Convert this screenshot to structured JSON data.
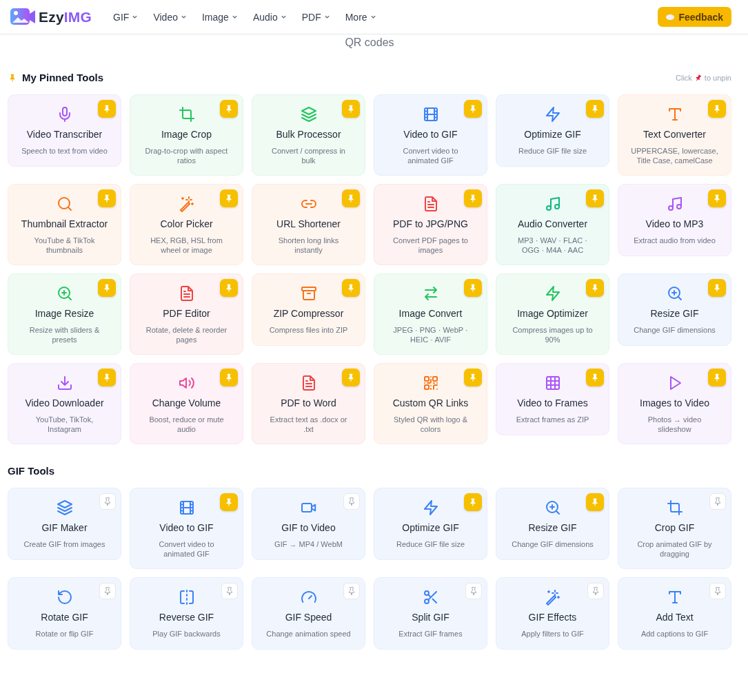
{
  "header": {
    "brand": {
      "name": "Ezy",
      "accent": "IMG"
    },
    "nav": [
      "GIF",
      "Video",
      "Image",
      "Audio",
      "PDF",
      "More"
    ],
    "feedback_button": "Feedback"
  },
  "intro_fragment": "QR codes",
  "sections": [
    {
      "title": "My Pinned Tools",
      "kind": "pinned",
      "hint": {
        "before": "Click",
        "after": "to unpin"
      },
      "tools": [
        {
          "title": "Video Transcriber",
          "description": "Speech to text from video",
          "kind": "mic",
          "color": "#a855f7",
          "pinned": true
        },
        {
          "title": "Image Crop",
          "description": "Drag-to-crop with aspect ratios",
          "kind": "crop",
          "color": "#22c55e",
          "pinned": true
        },
        {
          "title": "Bulk Processor",
          "description": "Convert / compress in bulk",
          "kind": "layers",
          "color": "#22c55e",
          "pinned": true
        },
        {
          "title": "Video to GIF",
          "description": "Convert video to animated GIF",
          "kind": "film",
          "color": "#3b82f6",
          "pinned": true
        },
        {
          "title": "Optimize GIF",
          "description": "Reduce GIF file size",
          "kind": "zap",
          "color": "#3b82f6",
          "pinned": true
        },
        {
          "title": "Text Converter",
          "description": "UPPERCASE, lowercase, Title Case, camelCase",
          "kind": "type",
          "color": "#f97316",
          "pinned": true
        },
        {
          "title": "Thumbnail Extractor",
          "description": "YouTube & TikTok thumbnails",
          "kind": "search",
          "color": "#f97316",
          "pinned": true
        },
        {
          "title": "Color Picker",
          "description": "HEX, RGB, HSL from wheel or image",
          "kind": "wand",
          "color": "#f97316",
          "pinned": true
        },
        {
          "title": "URL Shortener",
          "description": "Shorten long links instantly",
          "kind": "link",
          "color": "#f97316",
          "pinned": true
        },
        {
          "title": "PDF to JPG/PNG",
          "description": "Convert PDF pages to images",
          "kind": "file",
          "color": "#ef4444",
          "pinned": true
        },
        {
          "title": "Audio Converter",
          "description": "MP3 · WAV · FLAC · OGG · M4A · AAC",
          "kind": "music",
          "color": "#10b981",
          "pinned": true
        },
        {
          "title": "Video to MP3",
          "description": "Extract audio from video",
          "kind": "music",
          "color": "#a855f7",
          "pinned": true
        },
        {
          "title": "Image Resize",
          "description": "Resize with sliders & presets",
          "kind": "zoom",
          "color": "#22c55e",
          "pinned": true
        },
        {
          "title": "PDF Editor",
          "description": "Rotate, delete & reorder pages",
          "kind": "file",
          "color": "#ef4444",
          "pinned": true
        },
        {
          "title": "ZIP Compressor",
          "description": "Compress files into ZIP",
          "kind": "archive",
          "color": "#f97316",
          "pinned": true
        },
        {
          "title": "Image Convert",
          "description": "JPEG · PNG · WebP · HEIC · AVIF",
          "kind": "swap",
          "color": "#22c55e",
          "pinned": true
        },
        {
          "title": "Image Optimizer",
          "description": "Compress images up to 90%",
          "kind": "zap",
          "color": "#22c55e",
          "pinned": true
        },
        {
          "title": "Resize GIF",
          "description": "Change GIF dimensions",
          "kind": "zoom",
          "color": "#3b82f6",
          "pinned": true
        },
        {
          "title": "Video Downloader",
          "description": "YouTube, TikTok, Instagram",
          "kind": "download",
          "color": "#a855f7",
          "pinned": true
        },
        {
          "title": "Change Volume",
          "description": "Boost, reduce or mute audio",
          "kind": "volume",
          "color": "#ec4899",
          "pinned": true
        },
        {
          "title": "PDF to Word",
          "description": "Extract text as .docx or .txt",
          "kind": "file",
          "color": "#ef4444",
          "pinned": true
        },
        {
          "title": "Custom QR Links",
          "description": "Styled QR with logo & colors",
          "kind": "qr",
          "color": "#f97316",
          "pinned": true
        },
        {
          "title": "Video to Frames",
          "description": "Extract frames as ZIP",
          "kind": "grid",
          "color": "#a855f7",
          "pinned": true
        },
        {
          "title": "Images to Video",
          "description": "Photos → video slideshow",
          "kind": "play",
          "color": "#a855f7",
          "pinned": true
        }
      ]
    },
    {
      "title": "GIF Tools",
      "kind": "plain",
      "tools": [
        {
          "title": "GIF Maker",
          "description": "Create GIF from images",
          "kind": "layers",
          "color": "#3b82f6",
          "pinned": false
        },
        {
          "title": "Video to GIF",
          "description": "Convert video to animated GIF",
          "kind": "film",
          "color": "#3b82f6",
          "pinned": true
        },
        {
          "title": "GIF to Video",
          "description": "GIF → MP4 / WebM",
          "kind": "video",
          "color": "#3b82f6",
          "pinned": false
        },
        {
          "title": "Optimize GIF",
          "description": "Reduce GIF file size",
          "kind": "zap",
          "color": "#3b82f6",
          "pinned": true
        },
        {
          "title": "Resize GIF",
          "description": "Change GIF dimensions",
          "kind": "zoom",
          "color": "#3b82f6",
          "pinned": true
        },
        {
          "title": "Crop GIF",
          "description": "Crop animated GIF by dragging",
          "kind": "crop",
          "color": "#3b82f6",
          "pinned": false
        },
        {
          "title": "Rotate GIF",
          "description": "Rotate or flip GIF",
          "kind": "rotate",
          "color": "#3b82f6",
          "pinned": false
        },
        {
          "title": "Reverse GIF",
          "description": "Play GIF backwards",
          "kind": "split",
          "color": "#3b82f6",
          "pinned": false
        },
        {
          "title": "GIF Speed",
          "description": "Change animation speed",
          "kind": "gauge",
          "color": "#3b82f6",
          "pinned": false
        },
        {
          "title": "Split GIF",
          "description": "Extract GIF frames",
          "kind": "scissors",
          "color": "#3b82f6",
          "pinned": false
        },
        {
          "title": "GIF Effects",
          "description": "Apply filters to GIF",
          "kind": "wand",
          "color": "#3b82f6",
          "pinned": false
        },
        {
          "title": "Add Text",
          "description": "Add captions to GIF",
          "kind": "type",
          "color": "#3b82f6",
          "pinned": false
        }
      ]
    }
  ]
}
